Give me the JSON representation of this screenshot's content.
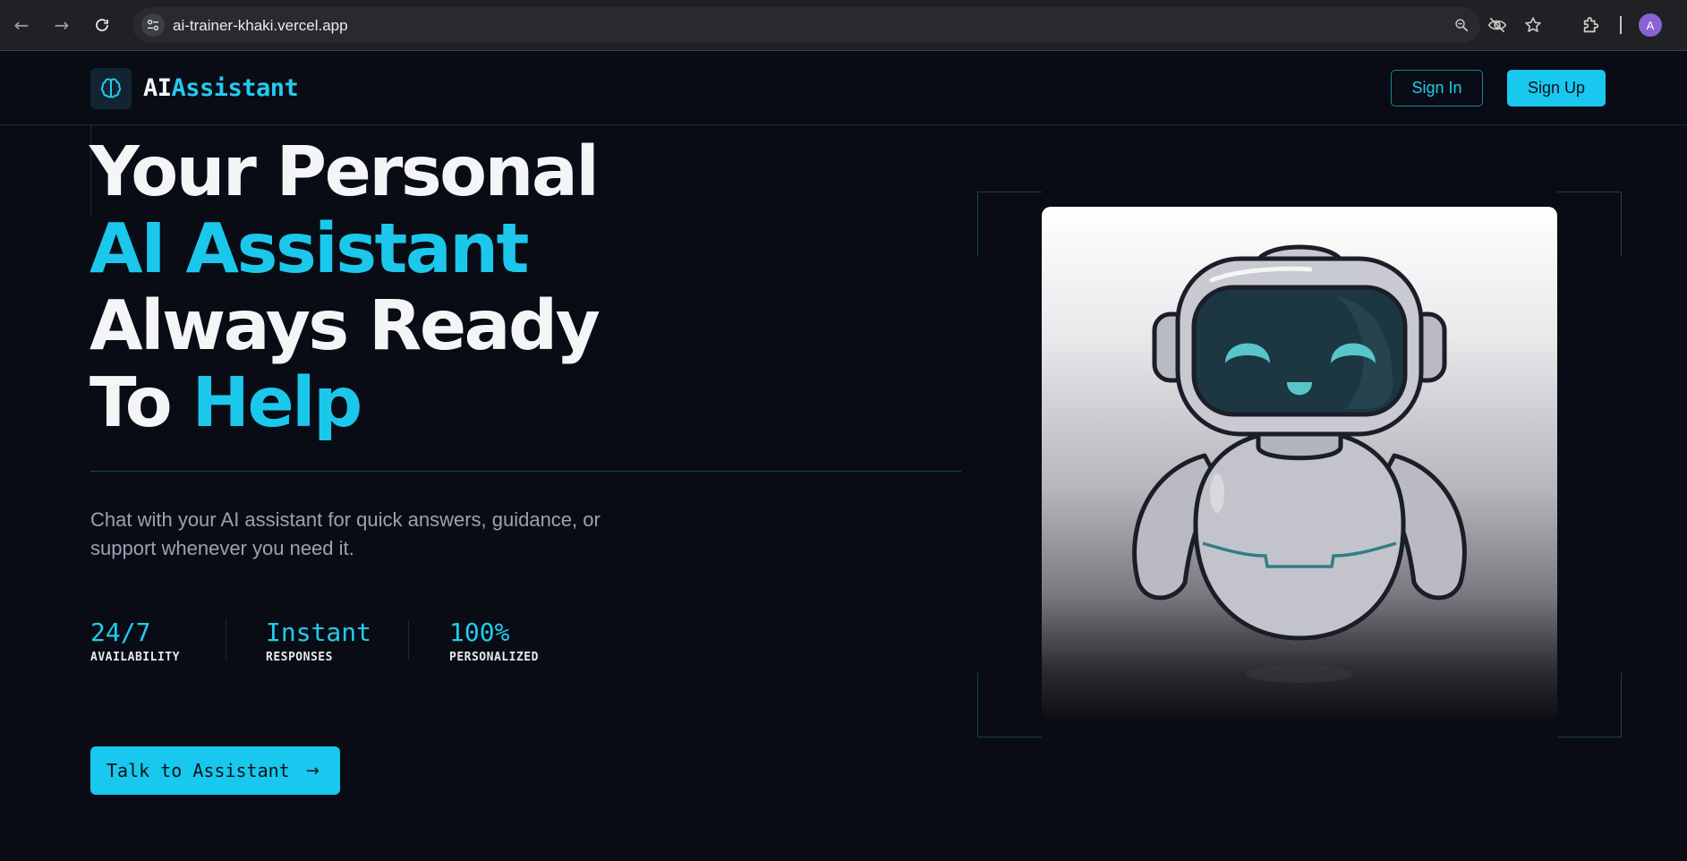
{
  "browser": {
    "url": "ai-trainer-khaki.vercel.app",
    "profile_initial": "A"
  },
  "header": {
    "logo_ai": "AI",
    "logo_assistant": "Assistant",
    "sign_in": "Sign In",
    "sign_up": "Sign Up"
  },
  "hero": {
    "line1": "Your Personal",
    "line2": "AI Assistant",
    "line3": "Always Ready",
    "line4_prefix": "To",
    "line4_highlight": "Help",
    "subtext": "Chat with your AI assistant for quick answers, guidance, or support whenever you need it.",
    "stats": [
      {
        "value": "24/7",
        "label": "AVAILABILITY"
      },
      {
        "value": "Instant",
        "label": "RESPONSES"
      },
      {
        "value": "100%",
        "label": "PERSONALIZED"
      }
    ],
    "cta": "Talk to Assistant"
  },
  "colors": {
    "background": "#090c14",
    "accent": "#18c8ee",
    "text": "#f4f5f7",
    "muted": "#9aa3b2"
  }
}
